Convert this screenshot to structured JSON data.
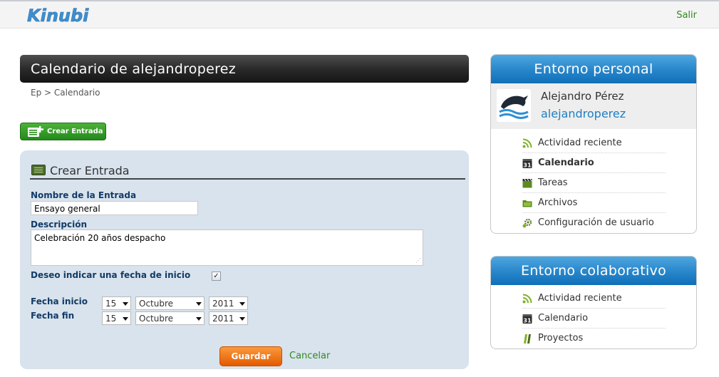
{
  "header": {
    "logo_text": "Kinubi",
    "logout_label": "Salir"
  },
  "page": {
    "title": "Calendario de alejandroperez",
    "breadcrumb": "Ep > Calendario"
  },
  "create_button": {
    "label": "Crear  Entrada"
  },
  "form": {
    "title": "Crear Entrada",
    "name_label": "Nombre de la Entrada",
    "name_value": "Ensayo general",
    "description_label": "Descripción",
    "description_value": "Celebración 20 años despacho",
    "start_date_checkbox_label": "Deseo indicar una fecha de inicio",
    "start_date_checked": true,
    "start_label": "Fecha inicio",
    "end_label": "Fecha fin",
    "start": {
      "day": "15",
      "month": "Octubre",
      "year": "2011"
    },
    "end": {
      "day": "15",
      "month": "Octubre",
      "year": "2011"
    },
    "save_label": "Guardar",
    "cancel_label": "Cancelar"
  },
  "personal": {
    "title": "Entorno personal",
    "full_name": "Alejandro Pérez",
    "username": "alejandroperez",
    "items": [
      {
        "label": "Actividad reciente",
        "icon": "rss-icon"
      },
      {
        "label": "Calendario",
        "icon": "calendar-icon",
        "active": true
      },
      {
        "label": "Tareas",
        "icon": "clapperboard-icon"
      },
      {
        "label": "Archivos",
        "icon": "folder-icon"
      },
      {
        "label": "Configuración de usuario",
        "icon": "gear-icon"
      }
    ]
  },
  "collab": {
    "title": "Entorno colaborativo",
    "items": [
      {
        "label": "Actividad reciente",
        "icon": "rss-icon"
      },
      {
        "label": "Calendario",
        "icon": "calendar-icon"
      },
      {
        "label": "Proyectos",
        "icon": "projects-icon"
      }
    ]
  },
  "colors": {
    "accent_green": "#2e8a1e",
    "accent_blue": "#1d7ec2",
    "save_orange": "#f07a14"
  }
}
